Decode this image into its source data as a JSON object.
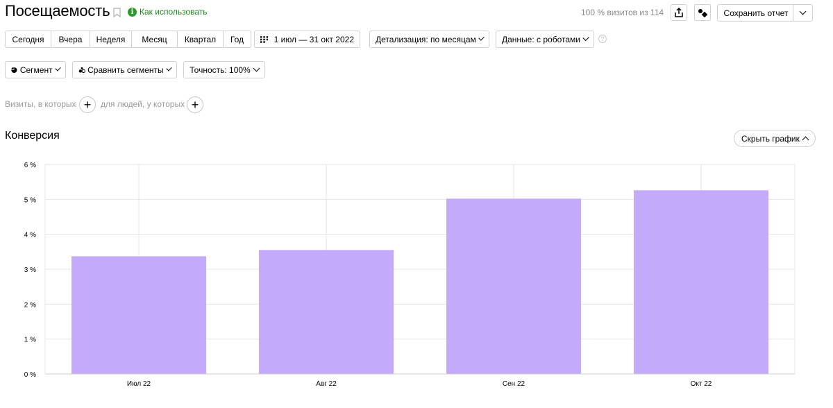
{
  "header": {
    "title": "Посещаемость",
    "howto_label": "Как использовать",
    "visits_share": "100 % визитов из 114",
    "save_report": "Сохранить отчет"
  },
  "periods": [
    "Сегодня",
    "Вчера",
    "Неделя",
    "Месяц",
    "Квартал",
    "Год"
  ],
  "toolbar": {
    "date_range": "1 июл — 31 окт 2022",
    "detail": "Детализация: по месяцам",
    "data": "Данные: с роботами"
  },
  "segments": {
    "segment": "Сегмент",
    "compare": "Сравнить сегменты",
    "accuracy": "Точность: 100%"
  },
  "filters": {
    "visits_label": "Визиты, в которых",
    "people_label": "для людей, у которых"
  },
  "section": {
    "title": "Конверсия",
    "hide_chart": "Скрыть график"
  },
  "colors": {
    "bar": "#c4aafb",
    "grid": "#e6e6e6",
    "green": "#2a9a2a"
  },
  "chart_data": {
    "type": "bar",
    "categories": [
      "Июл 22",
      "Авг 22",
      "Сен 22",
      "Окт 22"
    ],
    "values": [
      3.37,
      3.55,
      5.02,
      5.26
    ],
    "yticks": [
      "0 %",
      "1 %",
      "2 %",
      "3 %",
      "4 %",
      "5 %",
      "6 %"
    ],
    "ylim": [
      0,
      6
    ],
    "grid": true,
    "xlabel": "",
    "ylabel": ""
  }
}
